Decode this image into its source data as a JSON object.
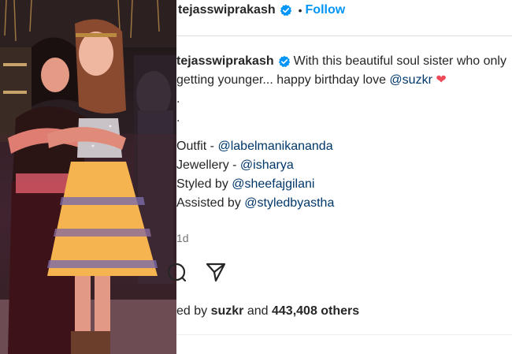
{
  "header": {
    "username": "tejasswiprakash",
    "separator": "•",
    "follow_label": "Follow"
  },
  "caption": {
    "username": "tejasswiprakash",
    "text_line1": "With this beautiful soul sister who only",
    "text_line2": "getting younger... happy birthday love",
    "mention_suzkr": "@suzkr",
    "heart": "❤",
    "dot1": ".",
    "dot2": ".",
    "outfit_label": "Outfit -",
    "outfit_mention": "@labelmanikananda",
    "jewellery_label": "Jewellery -",
    "jewellery_mention": "@isharya",
    "styled_label": "Styled by",
    "styled_mention": "@sheefajgilani",
    "assisted_label": "Assisted by",
    "assisted_mention": "@styledbyastha"
  },
  "timestamp": "1d",
  "likes": {
    "prefix": "ed by",
    "liker": "suzkr",
    "and": "and",
    "count": "443,408 others"
  },
  "icons": {
    "verified": "verified-badge-icon",
    "comment": "comment-icon",
    "share": "share-icon"
  },
  "colors": {
    "follow": "#0095f6",
    "mention": "#00376b",
    "verified": "#0095f6",
    "heart": "#ed4956",
    "muted": "#737373"
  }
}
